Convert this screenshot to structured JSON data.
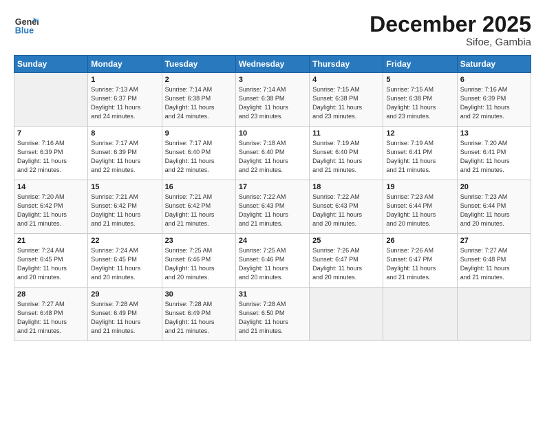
{
  "header": {
    "logo_line1": "General",
    "logo_line2": "Blue",
    "month_title": "December 2025",
    "location": "Sifoe, Gambia"
  },
  "days_of_week": [
    "Sunday",
    "Monday",
    "Tuesday",
    "Wednesday",
    "Thursday",
    "Friday",
    "Saturday"
  ],
  "weeks": [
    [
      {
        "day": "",
        "detail": ""
      },
      {
        "day": "1",
        "detail": "Sunrise: 7:13 AM\nSunset: 6:37 PM\nDaylight: 11 hours\nand 24 minutes."
      },
      {
        "day": "2",
        "detail": "Sunrise: 7:14 AM\nSunset: 6:38 PM\nDaylight: 11 hours\nand 24 minutes."
      },
      {
        "day": "3",
        "detail": "Sunrise: 7:14 AM\nSunset: 6:38 PM\nDaylight: 11 hours\nand 23 minutes."
      },
      {
        "day": "4",
        "detail": "Sunrise: 7:15 AM\nSunset: 6:38 PM\nDaylight: 11 hours\nand 23 minutes."
      },
      {
        "day": "5",
        "detail": "Sunrise: 7:15 AM\nSunset: 6:38 PM\nDaylight: 11 hours\nand 23 minutes."
      },
      {
        "day": "6",
        "detail": "Sunrise: 7:16 AM\nSunset: 6:39 PM\nDaylight: 11 hours\nand 22 minutes."
      }
    ],
    [
      {
        "day": "7",
        "detail": "Sunrise: 7:16 AM\nSunset: 6:39 PM\nDaylight: 11 hours\nand 22 minutes."
      },
      {
        "day": "8",
        "detail": "Sunrise: 7:17 AM\nSunset: 6:39 PM\nDaylight: 11 hours\nand 22 minutes."
      },
      {
        "day": "9",
        "detail": "Sunrise: 7:17 AM\nSunset: 6:40 PM\nDaylight: 11 hours\nand 22 minutes."
      },
      {
        "day": "10",
        "detail": "Sunrise: 7:18 AM\nSunset: 6:40 PM\nDaylight: 11 hours\nand 22 minutes."
      },
      {
        "day": "11",
        "detail": "Sunrise: 7:19 AM\nSunset: 6:40 PM\nDaylight: 11 hours\nand 21 minutes."
      },
      {
        "day": "12",
        "detail": "Sunrise: 7:19 AM\nSunset: 6:41 PM\nDaylight: 11 hours\nand 21 minutes."
      },
      {
        "day": "13",
        "detail": "Sunrise: 7:20 AM\nSunset: 6:41 PM\nDaylight: 11 hours\nand 21 minutes."
      }
    ],
    [
      {
        "day": "14",
        "detail": "Sunrise: 7:20 AM\nSunset: 6:42 PM\nDaylight: 11 hours\nand 21 minutes."
      },
      {
        "day": "15",
        "detail": "Sunrise: 7:21 AM\nSunset: 6:42 PM\nDaylight: 11 hours\nand 21 minutes."
      },
      {
        "day": "16",
        "detail": "Sunrise: 7:21 AM\nSunset: 6:42 PM\nDaylight: 11 hours\nand 21 minutes."
      },
      {
        "day": "17",
        "detail": "Sunrise: 7:22 AM\nSunset: 6:43 PM\nDaylight: 11 hours\nand 21 minutes."
      },
      {
        "day": "18",
        "detail": "Sunrise: 7:22 AM\nSunset: 6:43 PM\nDaylight: 11 hours\nand 20 minutes."
      },
      {
        "day": "19",
        "detail": "Sunrise: 7:23 AM\nSunset: 6:44 PM\nDaylight: 11 hours\nand 20 minutes."
      },
      {
        "day": "20",
        "detail": "Sunrise: 7:23 AM\nSunset: 6:44 PM\nDaylight: 11 hours\nand 20 minutes."
      }
    ],
    [
      {
        "day": "21",
        "detail": "Sunrise: 7:24 AM\nSunset: 6:45 PM\nDaylight: 11 hours\nand 20 minutes."
      },
      {
        "day": "22",
        "detail": "Sunrise: 7:24 AM\nSunset: 6:45 PM\nDaylight: 11 hours\nand 20 minutes."
      },
      {
        "day": "23",
        "detail": "Sunrise: 7:25 AM\nSunset: 6:46 PM\nDaylight: 11 hours\nand 20 minutes."
      },
      {
        "day": "24",
        "detail": "Sunrise: 7:25 AM\nSunset: 6:46 PM\nDaylight: 11 hours\nand 20 minutes."
      },
      {
        "day": "25",
        "detail": "Sunrise: 7:26 AM\nSunset: 6:47 PM\nDaylight: 11 hours\nand 20 minutes."
      },
      {
        "day": "26",
        "detail": "Sunrise: 7:26 AM\nSunset: 6:47 PM\nDaylight: 11 hours\nand 21 minutes."
      },
      {
        "day": "27",
        "detail": "Sunrise: 7:27 AM\nSunset: 6:48 PM\nDaylight: 11 hours\nand 21 minutes."
      }
    ],
    [
      {
        "day": "28",
        "detail": "Sunrise: 7:27 AM\nSunset: 6:48 PM\nDaylight: 11 hours\nand 21 minutes."
      },
      {
        "day": "29",
        "detail": "Sunrise: 7:28 AM\nSunset: 6:49 PM\nDaylight: 11 hours\nand 21 minutes."
      },
      {
        "day": "30",
        "detail": "Sunrise: 7:28 AM\nSunset: 6:49 PM\nDaylight: 11 hours\nand 21 minutes."
      },
      {
        "day": "31",
        "detail": "Sunrise: 7:28 AM\nSunset: 6:50 PM\nDaylight: 11 hours\nand 21 minutes."
      },
      {
        "day": "",
        "detail": ""
      },
      {
        "day": "",
        "detail": ""
      },
      {
        "day": "",
        "detail": ""
      }
    ]
  ]
}
